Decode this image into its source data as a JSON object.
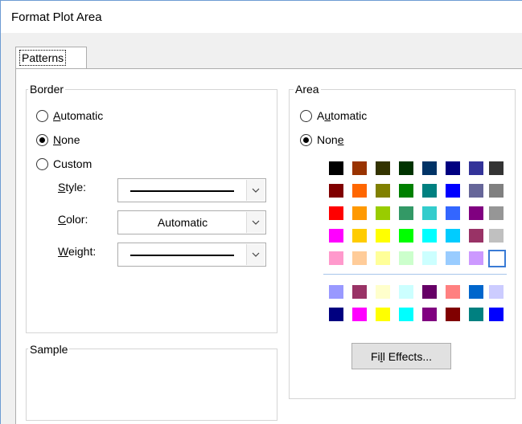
{
  "window": {
    "title": "Format Plot Area"
  },
  "tabs": [
    {
      "label": "Patterns"
    }
  ],
  "border": {
    "group_label": "Border",
    "options": [
      {
        "label_pre": "",
        "label_u": "A",
        "label_post": "utomatic",
        "checked": false
      },
      {
        "label_pre": "",
        "label_u": "N",
        "label_post": "one",
        "checked": true
      },
      {
        "label_pre": "",
        "label_u": "",
        "label_post": "Custom",
        "checked": false
      }
    ],
    "style_label_u": "S",
    "style_label_post": "tyle:",
    "color_label_u": "C",
    "color_label_post": "olor:",
    "weight_label_u": "W",
    "weight_label_post": "eight:",
    "color_value": "Automatic"
  },
  "sample": {
    "group_label": "Sample"
  },
  "area": {
    "group_label": "Area",
    "options": [
      {
        "label_pre": "A",
        "label_u": "u",
        "label_post": "tomatic",
        "checked": false
      },
      {
        "label_pre": "Non",
        "label_u": "e",
        "label_post": "",
        "checked": true
      }
    ],
    "palette": [
      [
        "#000000",
        "#993300",
        "#333300",
        "#003300",
        "#003366",
        "#000080",
        "#333399",
        "#333333"
      ],
      [
        "#800000",
        "#ff6600",
        "#808000",
        "#008000",
        "#008080",
        "#0000ff",
        "#666699",
        "#808080"
      ],
      [
        "#ff0000",
        "#ff9900",
        "#99cc00",
        "#339966",
        "#33cccc",
        "#3366ff",
        "#800080",
        "#969696"
      ],
      [
        "#ff00ff",
        "#ffcc00",
        "#ffff00",
        "#00ff00",
        "#00ffff",
        "#00ccff",
        "#993366",
        "#c0c0c0"
      ],
      [
        "#ff99cc",
        "#ffcc99",
        "#ffff99",
        "#ccffcc",
        "#ccffff",
        "#99ccff",
        "#cc99ff",
        "#ffffff"
      ]
    ],
    "palette_extra": [
      [
        "#9999ff",
        "#993366",
        "#ffffcc",
        "#ccffff",
        "#660066",
        "#ff8080",
        "#0066cc",
        "#ccccff"
      ],
      [
        "#000080",
        "#ff00ff",
        "#ffff00",
        "#00ffff",
        "#800080",
        "#800000",
        "#008080",
        "#0000ff"
      ]
    ],
    "selected_swatch": "row 5, column 8",
    "fill_effects_pre": "Fi",
    "fill_effects_u": "l",
    "fill_effects_post": "l Effects..."
  }
}
